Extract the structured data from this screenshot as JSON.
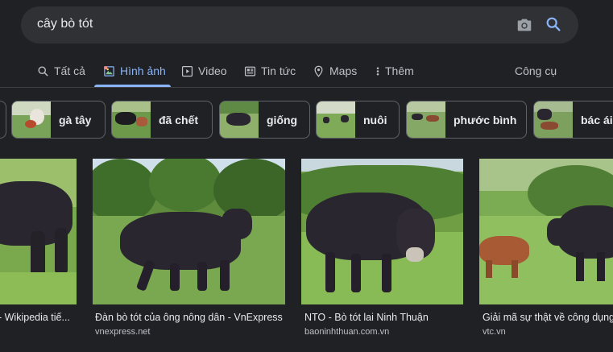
{
  "search": {
    "query": "cây bò tót"
  },
  "tabs": [
    {
      "label": "Tất cả",
      "icon": "search-icon"
    },
    {
      "label": "Hình ảnh",
      "icon": "image-icon"
    },
    {
      "label": "Video",
      "icon": "play-icon"
    },
    {
      "label": "Tin tức",
      "icon": "news-icon"
    },
    {
      "label": "Maps",
      "icon": "map-pin-icon"
    },
    {
      "label": "Thêm",
      "icon": "more-vert-icon"
    },
    {
      "label": "Công cụ"
    }
  ],
  "active_tab": "Hình ảnh",
  "chips": [
    {
      "label": "gà tây"
    },
    {
      "label": "đã chết"
    },
    {
      "label": "giống"
    },
    {
      "label": "nuôi"
    },
    {
      "label": "phước bình"
    },
    {
      "label": "bác ái"
    }
  ],
  "results": [
    {
      "title": "- Wikipedia tiế...",
      "source": ""
    },
    {
      "title": "Đàn bò tót của ông nông dân - VnExpress",
      "source": "vnexpress.net"
    },
    {
      "title": "NTO - Bò tót lai Ninh Thuận",
      "source": "baoninhthuan.com.vn"
    },
    {
      "title": "Giải mã sự thật về công dụng",
      "source": "vtc.vn"
    }
  ],
  "colors": {
    "background": "#202124",
    "search_bar": "#303134",
    "accent": "#8ab4f8",
    "text": "#e8eaed",
    "muted": "#bdc1c6"
  }
}
